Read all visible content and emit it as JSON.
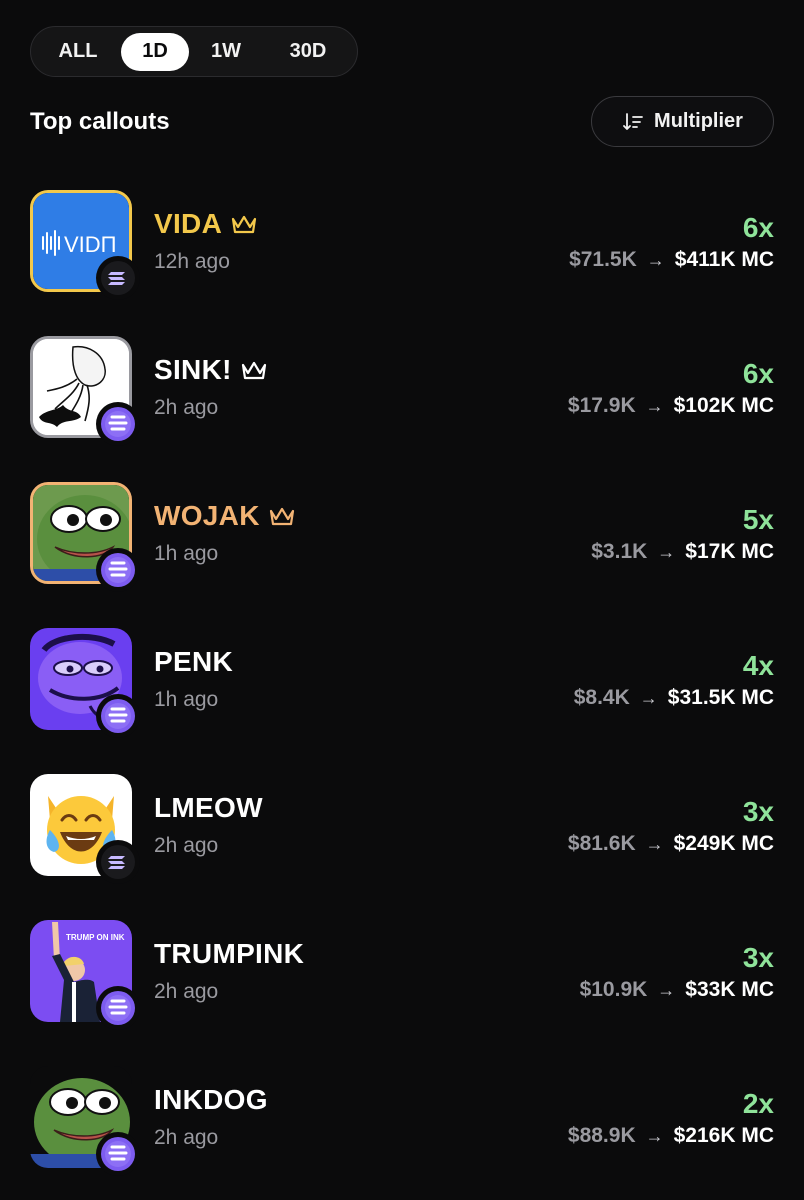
{
  "timeframe": {
    "tabs": [
      {
        "label": "ALL",
        "active": false
      },
      {
        "label": "1D",
        "active": true
      },
      {
        "label": "1W",
        "active": false
      },
      {
        "label": "30D",
        "active": false
      }
    ]
  },
  "header": {
    "title": "Top callouts",
    "sort_label": "Multiplier",
    "sort_icon": "sort-descending-icon"
  },
  "colors": {
    "gold": "#f3c84b",
    "orange": "#f2b374",
    "green": "#8fe39a",
    "muted": "#9a9aa0"
  },
  "callouts": [
    {
      "name": "VIDA",
      "age": "12h ago",
      "multiplier": "6x",
      "mc_from": "$71.5K",
      "mc_to": "$411K MC",
      "chain": "solana",
      "crowned": true,
      "avatar_text": "VIDΠ"
    },
    {
      "name": "SINK!",
      "age": "2h ago",
      "multiplier": "6x",
      "mc_from": "$17.9K",
      "mc_to": "$102K MC",
      "chain": "ink",
      "crowned": true
    },
    {
      "name": "WOJAK",
      "age": "1h ago",
      "multiplier": "5x",
      "mc_from": "$3.1K",
      "mc_to": "$17K MC",
      "chain": "ink",
      "crowned": true
    },
    {
      "name": "PENK",
      "age": "1h ago",
      "multiplier": "4x",
      "mc_from": "$8.4K",
      "mc_to": "$31.5K MC",
      "chain": "ink",
      "crowned": false
    },
    {
      "name": "LMEOW",
      "age": "2h ago",
      "multiplier": "3x",
      "mc_from": "$81.6K",
      "mc_to": "$249K MC",
      "chain": "solana",
      "crowned": false
    },
    {
      "name": "TRUMPINK",
      "age": "2h ago",
      "multiplier": "3x",
      "mc_from": "$10.9K",
      "mc_to": "$33K MC",
      "chain": "ink",
      "crowned": false,
      "avatar_text": "TRUMP ON INK"
    },
    {
      "name": "INKDOG",
      "age": "2h ago",
      "multiplier": "2x",
      "mc_from": "$88.9K",
      "mc_to": "$216K MC",
      "chain": "ink",
      "crowned": false
    }
  ]
}
